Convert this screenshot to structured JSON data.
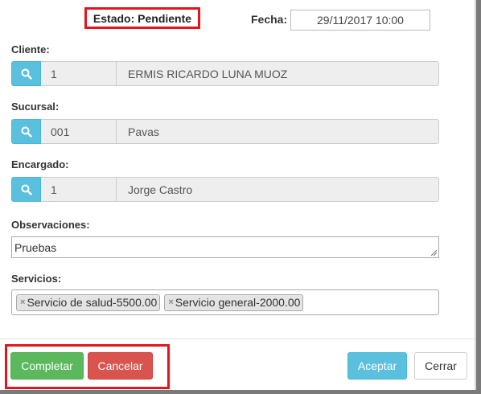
{
  "header": {
    "estado": "Estado: Pendiente",
    "fecha_label": "Fecha:",
    "fecha_value": "29/11/2017 10:00"
  },
  "cliente": {
    "label": "Cliente:",
    "code": "1",
    "name": "ERMIS RICARDO LUNA MUOZ"
  },
  "sucursal": {
    "label": "Sucursal:",
    "code": "001",
    "name": "Pavas"
  },
  "encargado": {
    "label": "Encargado:",
    "code": "1",
    "name": "Jorge Castro"
  },
  "observaciones": {
    "label": "Observaciones:",
    "value": "Pruebas"
  },
  "servicios": {
    "label": "Servicios:",
    "remove_symbol": "×",
    "tags": [
      "Servicio de salud-5500.00",
      "Servicio general-2000.00"
    ]
  },
  "footer": {
    "completar": "Completar",
    "cancelar": "Cancelar",
    "aceptar": "Aceptar",
    "cerrar": "Cerrar"
  },
  "colors": {
    "highlight": "#e2141c",
    "info": "#5bc0de",
    "success": "#5cb85c",
    "danger": "#d9534f"
  },
  "icons": {
    "lookup": "search-icon",
    "textarea": "resize-grip-icon"
  }
}
